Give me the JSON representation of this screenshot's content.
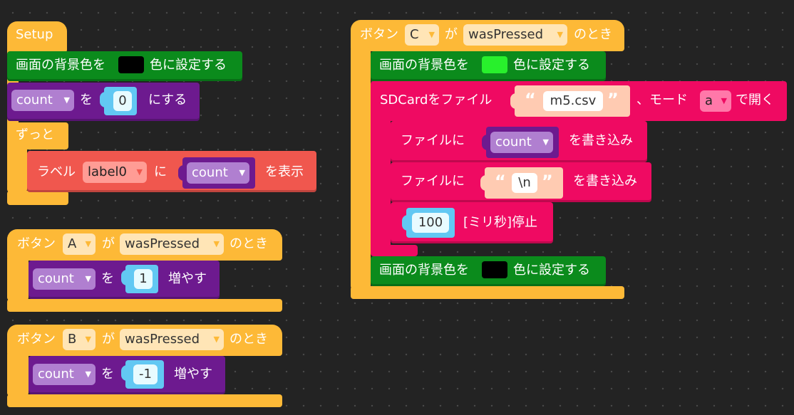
{
  "colors": {
    "control": "#fdb937",
    "display": "#0b8b1c",
    "variable": "#6d1a8f",
    "label": "#f0574e",
    "sdcard": "#ef0a62",
    "number": "#62c8f3",
    "string": "#ffcbb2",
    "swatch_black": "#000000",
    "swatch_green": "#28f02c"
  },
  "setup": {
    "title": "Setup",
    "bg_prefix": "画面の背景色を",
    "bg_suffix": "色に設定する",
    "set_var": "count",
    "set_mid": "を",
    "set_value": "0",
    "set_suffix": "にする",
    "forever": "ずっと",
    "label_prefix": "ラベル",
    "label_name": "label0",
    "label_mid": "に",
    "label_var": "count",
    "label_suffix": "を表示"
  },
  "button_a": {
    "prefix": "ボタン",
    "button": "A",
    "mid": "が",
    "event": "wasPressed",
    "suffix": "のとき",
    "var": "count",
    "var_mid": "を",
    "value": "1",
    "action": "増やす"
  },
  "button_b": {
    "prefix": "ボタン",
    "button": "B",
    "mid": "が",
    "event": "wasPressed",
    "suffix": "のとき",
    "var": "count",
    "var_mid": "を",
    "value": "-1",
    "action": "増やす"
  },
  "button_c": {
    "prefix": "ボタン",
    "button": "C",
    "mid": "が",
    "event": "wasPressed",
    "suffix": "のとき",
    "bg1_prefix": "画面の背景色を",
    "bg1_suffix": "色に設定する",
    "sd_prefix": "SDCardをファイル",
    "sd_filename": "m5.csv",
    "sd_mode_label": "、モード",
    "sd_mode": "a",
    "sd_suffix": "で開く",
    "write1_prefix": "ファイルに",
    "write1_var": "count",
    "write1_suffix": "を書き込み",
    "write2_prefix": "ファイルに",
    "write2_value": "\\n",
    "write2_suffix": "を書き込み",
    "sleep_value": "100",
    "sleep_suffix": "[ミリ秒]停止",
    "bg2_prefix": "画面の背景色を",
    "bg2_suffix": "色に設定する"
  }
}
